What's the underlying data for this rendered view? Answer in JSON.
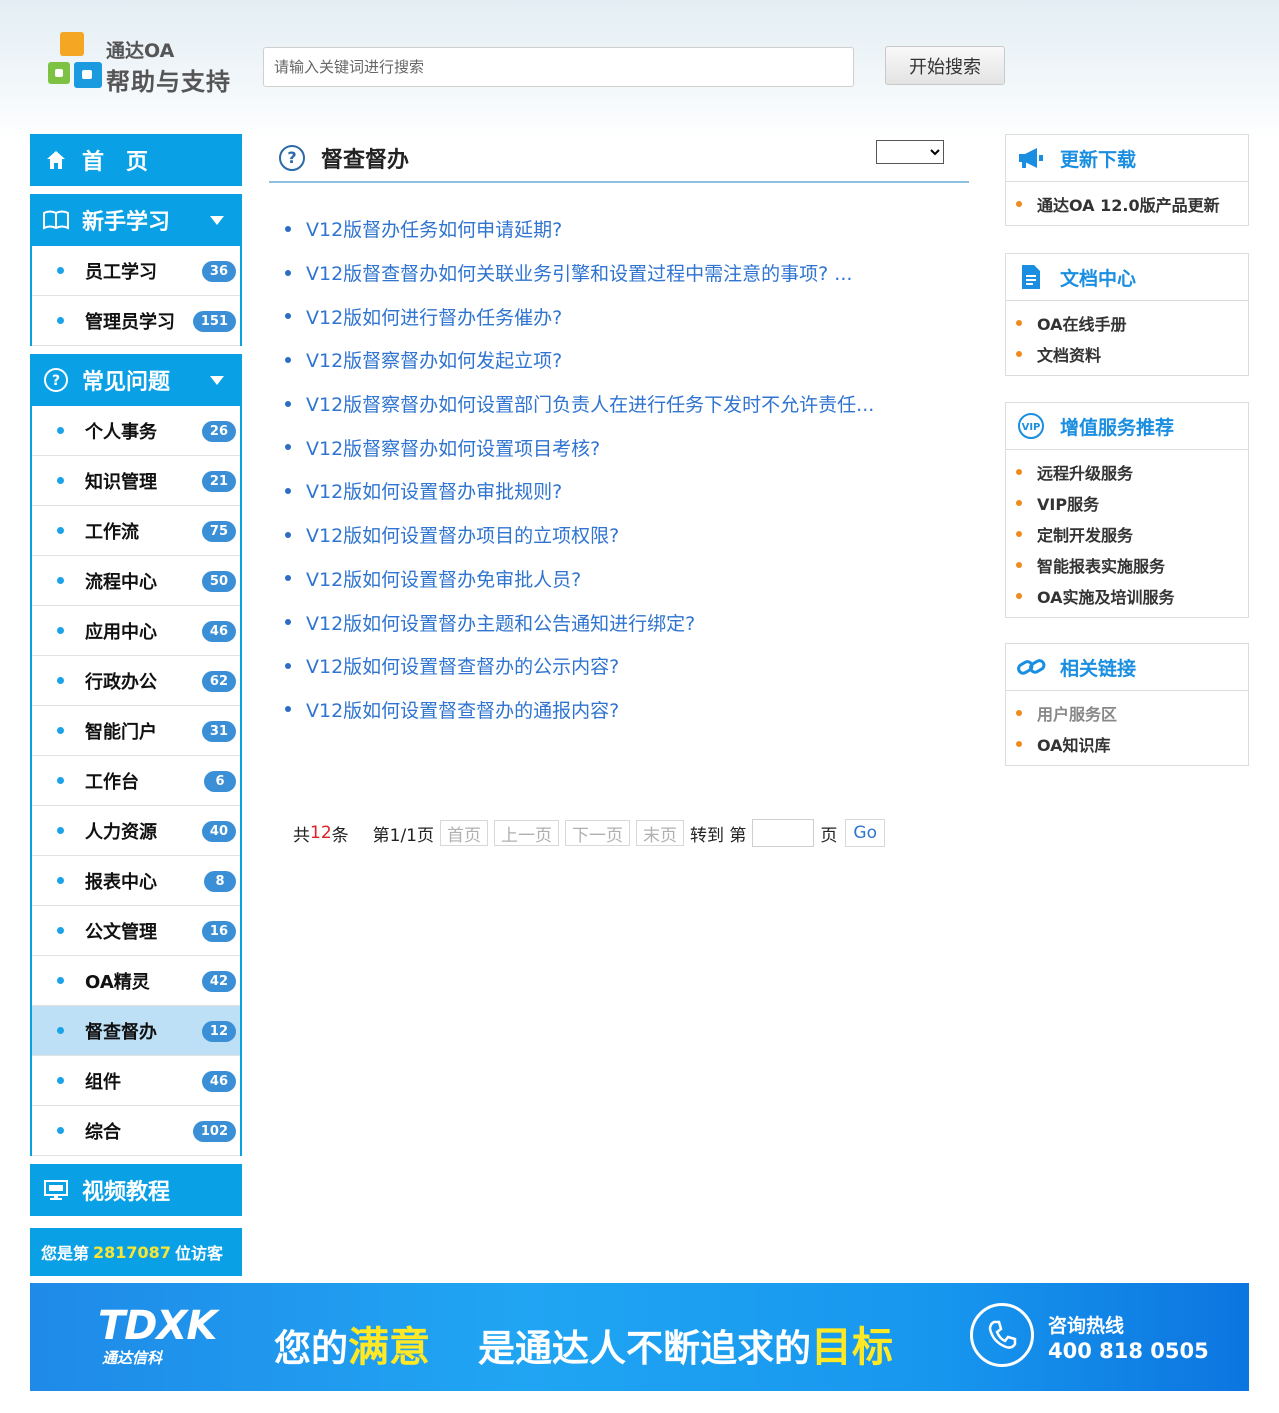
{
  "header": {
    "logo_line1": "通达OA",
    "logo_line2": "帮助与支持",
    "search_placeholder": "请输入关键词进行搜索",
    "search_button": "开始搜索"
  },
  "sidebar": {
    "home": "首　页",
    "newbie": {
      "label": "新手学习",
      "items": [
        {
          "label": "员工学习",
          "count": "36"
        },
        {
          "label": "管理员学习",
          "count": "151"
        }
      ]
    },
    "faq": {
      "label": "常见问题",
      "items": [
        {
          "label": "个人事务",
          "count": "26"
        },
        {
          "label": "知识管理",
          "count": "21"
        },
        {
          "label": "工作流",
          "count": "75"
        },
        {
          "label": "流程中心",
          "count": "50"
        },
        {
          "label": "应用中心",
          "count": "46"
        },
        {
          "label": "行政办公",
          "count": "62"
        },
        {
          "label": "智能门户",
          "count": "31"
        },
        {
          "label": "工作台",
          "count": "6"
        },
        {
          "label": "人力资源",
          "count": "40"
        },
        {
          "label": "报表中心",
          "count": "8"
        },
        {
          "label": "公文管理",
          "count": "16"
        },
        {
          "label": "OA精灵",
          "count": "42"
        },
        {
          "label": "督查督办",
          "count": "12"
        },
        {
          "label": "组件",
          "count": "46"
        },
        {
          "label": "综合",
          "count": "102"
        }
      ]
    },
    "video": "视频教程",
    "visitor_prefix": "您是第",
    "visitor_count": "2817087",
    "visitor_suffix": "位访客"
  },
  "main": {
    "title": "督查督办",
    "questions": [
      "V12版督办任务如何申请延期?",
      "V12版督查督办如何关联业务引擎和设置过程中需注意的事项? ...",
      "V12版如何进行督办任务催办?",
      "V12版督察督办如何发起立项?",
      "V12版督察督办如何设置部门负责人在进行任务下发时不允许责任...",
      "V12版督察督办如何设置项目考核?",
      "V12版如何设置督办审批规则?",
      "V12版如何设置督办项目的立项权限?",
      "V12版如何设置督办免审批人员?",
      "V12版如何设置督办主题和公告通知进行绑定?",
      "V12版如何设置督查督办的公示内容?",
      "V12版如何设置督查督办的通报内容?"
    ],
    "pager": {
      "total_prefix": "共",
      "total": "12",
      "total_suffix": "条",
      "page_info": "第1/1页",
      "first": "首页",
      "prev": "上一页",
      "next": "下一页",
      "last": "末页",
      "goto_prefix": "转到 第",
      "goto_suffix": "页",
      "go": "Go"
    }
  },
  "right": {
    "downloads": {
      "title": "更新下载",
      "items": [
        "通达OA 12.0版产品更新"
      ]
    },
    "docs": {
      "title": "文档中心",
      "items": [
        "OA在线手册",
        "文档资料"
      ]
    },
    "services": {
      "title": "增值服务推荐",
      "items": [
        "远程升级服务",
        "VIP服务",
        "定制开发服务",
        "智能报表实施服务",
        "OA实施及培训服务"
      ]
    },
    "links": {
      "title": "相关链接",
      "items": [
        "用户服务区",
        "OA知识库"
      ]
    }
  },
  "banner": {
    "brand": "TDXK",
    "brand_cn": "通达信科",
    "slogan_a": "您的",
    "slogan_b": "满意",
    "slogan_c": "是通达人不断追求的",
    "slogan_d": "目标",
    "hotline_label": "咨询热线",
    "hotline_number": "400 818 0505"
  },
  "colors": {
    "sidebar_blue": "#0aa0e6",
    "link_blue": "#2f74d0",
    "badge_blue": "#3a8fd6",
    "active_item_bg": "#bde0f7",
    "right_dot_orange": "#f08a1d",
    "slogan_yellow": "#ffe824"
  }
}
